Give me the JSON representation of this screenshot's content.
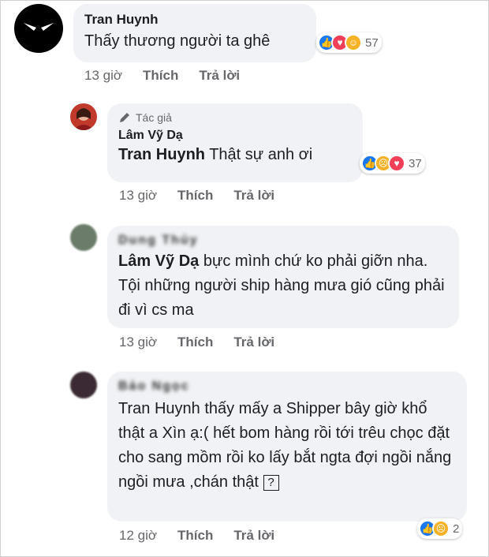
{
  "comments": [
    {
      "author": "Tran Huynh",
      "text": "Thấy thương người ta ghê",
      "reaction_count": "57",
      "time": "13 giờ",
      "like_label": "Thích",
      "reply_label": "Trả lời"
    },
    {
      "badge": "Tác giả",
      "author": "Lâm Vỹ Dạ",
      "mention": "Tran Huynh",
      "text": "Thật sự anh ơi",
      "reaction_count": "37",
      "time": "13 giờ",
      "like_label": "Thích",
      "reply_label": "Trả lời"
    },
    {
      "author": "Dung Thủy",
      "mention": "Lâm Vỹ Dạ",
      "text": "bực mình chứ ko phải giỡn nha. Tội những người ship hàng mưa gió cũng phải đi vì cs ma",
      "time": "13 giờ",
      "like_label": "Thích",
      "reply_label": "Trả lời"
    },
    {
      "author": "Bảo Ngọc",
      "mention": "Tran Huynh",
      "text": "thấy mấy a Shipper bây giờ khổ thật a Xìn ạ:( hết bom hàng rồi tới trêu chọc đặt cho sang mồm rồi ko lấy bắt ngta đợi ngồi nắng ngồi mưa ,chán thật",
      "unknown_glyph": "?",
      "reaction_count": "2",
      "time": "12 giờ",
      "like_label": "Thích",
      "reply_label": "Trả lời"
    }
  ],
  "colors": {
    "bubble": "#f0f2f5",
    "meta": "#65676b",
    "like": "#1877f2",
    "love": "#f33e58",
    "haha": "#f7b125"
  }
}
